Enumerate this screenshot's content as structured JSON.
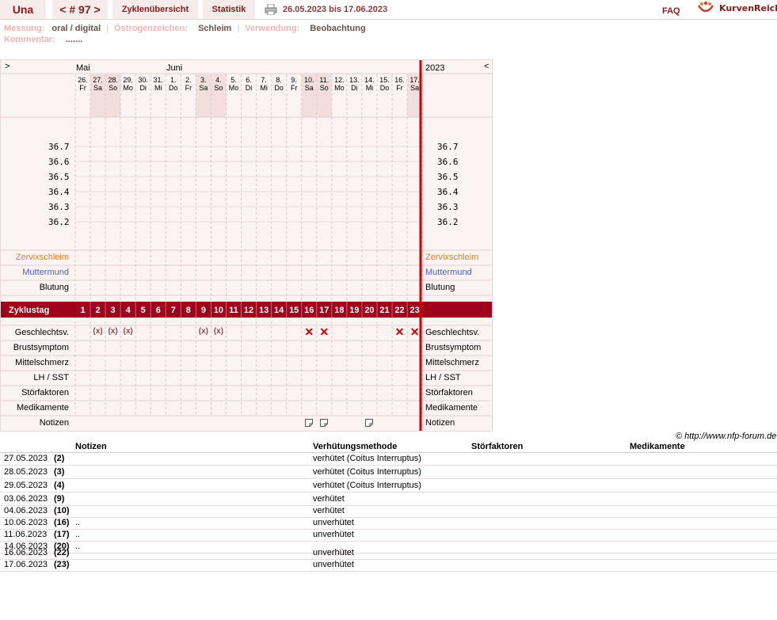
{
  "header": {
    "name": "Una",
    "cycle": "< # 97 >",
    "overview": "Zyklenübersicht",
    "stats": "Statistik",
    "date_range": "26.05.2023 bis 17.06.2023",
    "faq": "FAQ",
    "logo": "KurvenReich"
  },
  "info": {
    "measure_label": "Messung:",
    "measure_value": "oral / digital",
    "estrogen_label": "Östrogenzeichen:",
    "estrogen_value": "Schleim",
    "usage_label": "Verwendung:",
    "usage_value": "Beobachtung",
    "comment_label": "Kommentar:",
    "comment_value": "......."
  },
  "chart": {
    "nav_left": ">",
    "nav_right": "<",
    "months": [
      "Mai",
      "Juni"
    ],
    "year": "2023",
    "days": [
      {
        "d": "26.",
        "w": "Fr",
        "weekend": false
      },
      {
        "d": "27.",
        "w": "Sa",
        "weekend": true
      },
      {
        "d": "28.",
        "w": "So",
        "weekend": true
      },
      {
        "d": "29.",
        "w": "Mo",
        "weekend": false
      },
      {
        "d": "30.",
        "w": "Di",
        "weekend": false
      },
      {
        "d": "31.",
        "w": "Mi",
        "weekend": false
      },
      {
        "d": "1.",
        "w": "Do",
        "weekend": false
      },
      {
        "d": "2.",
        "w": "Fr",
        "weekend": false
      },
      {
        "d": "3.",
        "w": "Sa",
        "weekend": true
      },
      {
        "d": "4.",
        "w": "So",
        "weekend": true
      },
      {
        "d": "5.",
        "w": "Mo",
        "weekend": false
      },
      {
        "d": "6.",
        "w": "Di",
        "weekend": false
      },
      {
        "d": "7.",
        "w": "Mi",
        "weekend": false
      },
      {
        "d": "8.",
        "w": "Do",
        "weekend": false
      },
      {
        "d": "9.",
        "w": "Fr",
        "weekend": false
      },
      {
        "d": "10.",
        "w": "Sa",
        "weekend": true
      },
      {
        "d": "11.",
        "w": "So",
        "weekend": true
      },
      {
        "d": "12.",
        "w": "Mo",
        "weekend": false
      },
      {
        "d": "13.",
        "w": "Di",
        "weekend": false
      },
      {
        "d": "14.",
        "w": "Mi",
        "weekend": false
      },
      {
        "d": "15.",
        "w": "Do",
        "weekend": false
      },
      {
        "d": "16.",
        "w": "Fr",
        "weekend": false
      },
      {
        "d": "17.",
        "w": "Sa",
        "weekend": true
      }
    ],
    "temps": [
      "36.7",
      "36.6",
      "36.5",
      "36.4",
      "36.3",
      "36.2"
    ],
    "rows_top": [
      {
        "label": "Zervixschleim",
        "color": "#e67e22"
      },
      {
        "label": "Muttermund",
        "color": "#4a5fc1"
      },
      {
        "label": "Blutung",
        "color": "#000000"
      }
    ],
    "cycle_day_label": "Zyklustag",
    "cycle_days": [
      "1",
      "2",
      "3",
      "4",
      "5",
      "6",
      "7",
      "8",
      "9",
      "10",
      "11",
      "12",
      "13",
      "14",
      "15",
      "16",
      "17",
      "18",
      "19",
      "20",
      "21",
      "22",
      "23"
    ],
    "rows_bottom": [
      "Geschlechtsv.",
      "Brustsymptom",
      "Mittelschmerz",
      "LH / SST",
      "Störfaktoren",
      "Medikamente",
      "Notizen"
    ],
    "intercourse": [
      {
        "day": 2,
        "symbol": "(x)",
        "protected": true
      },
      {
        "day": 3,
        "symbol": "(x)",
        "protected": true
      },
      {
        "day": 4,
        "symbol": "(x)",
        "protected": true
      },
      {
        "day": 9,
        "symbol": "(x)",
        "protected": true
      },
      {
        "day": 10,
        "symbol": "(x)",
        "protected": true
      },
      {
        "day": 16,
        "symbol": "✕",
        "protected": false
      },
      {
        "day": 17,
        "symbol": "✕",
        "protected": false
      },
      {
        "day": 22,
        "symbol": "✕",
        "protected": false
      },
      {
        "day": 23,
        "symbol": "✕",
        "protected": false
      }
    ],
    "note_days": [
      16,
      17,
      20
    ],
    "colors": {
      "accent": "#a0001a",
      "weekend": "#f3dede",
      "bg": "#fcf3f3"
    }
  },
  "copyright": "© http://www.nfp-forum.de",
  "notes_table": {
    "headers": [
      "Notizen",
      "Verhütungsmethode",
      "Störfaktoren",
      "Medikamente"
    ],
    "rows": [
      {
        "date": "27.05.2023",
        "cd": "(2)",
        "note": "",
        "method": "verhütet (Coitus Interruptus)"
      },
      {
        "date": "28.05.2023",
        "cd": "(3)",
        "note": "",
        "method": "verhütet (Coitus Interruptus)"
      },
      {
        "date": "29.05.2023",
        "cd": "(4)",
        "note": "",
        "method": "verhütet (Coitus Interruptus)"
      },
      {
        "date": "03.06.2023",
        "cd": "(9)",
        "note": "",
        "method": "verhütet"
      },
      {
        "date": "04.06.2023",
        "cd": "(10)",
        "note": "",
        "method": "verhütet"
      },
      {
        "date": "10.06.2023",
        "cd": "(16)",
        "note": "..",
        "method": "unverhütet"
      },
      {
        "date": "11.06.2023",
        "cd": "(17)",
        "note": "..",
        "method": "unverhütet"
      },
      {
        "date": "14.06.2023",
        "cd": "(20)",
        "note": "..",
        "method": ""
      },
      {
        "date": "16.06.2023",
        "cd": "(22)",
        "note": "",
        "method": "unverhütet"
      },
      {
        "date": "17.06.2023",
        "cd": "(23)",
        "note": "",
        "method": "unverhütet"
      }
    ]
  }
}
